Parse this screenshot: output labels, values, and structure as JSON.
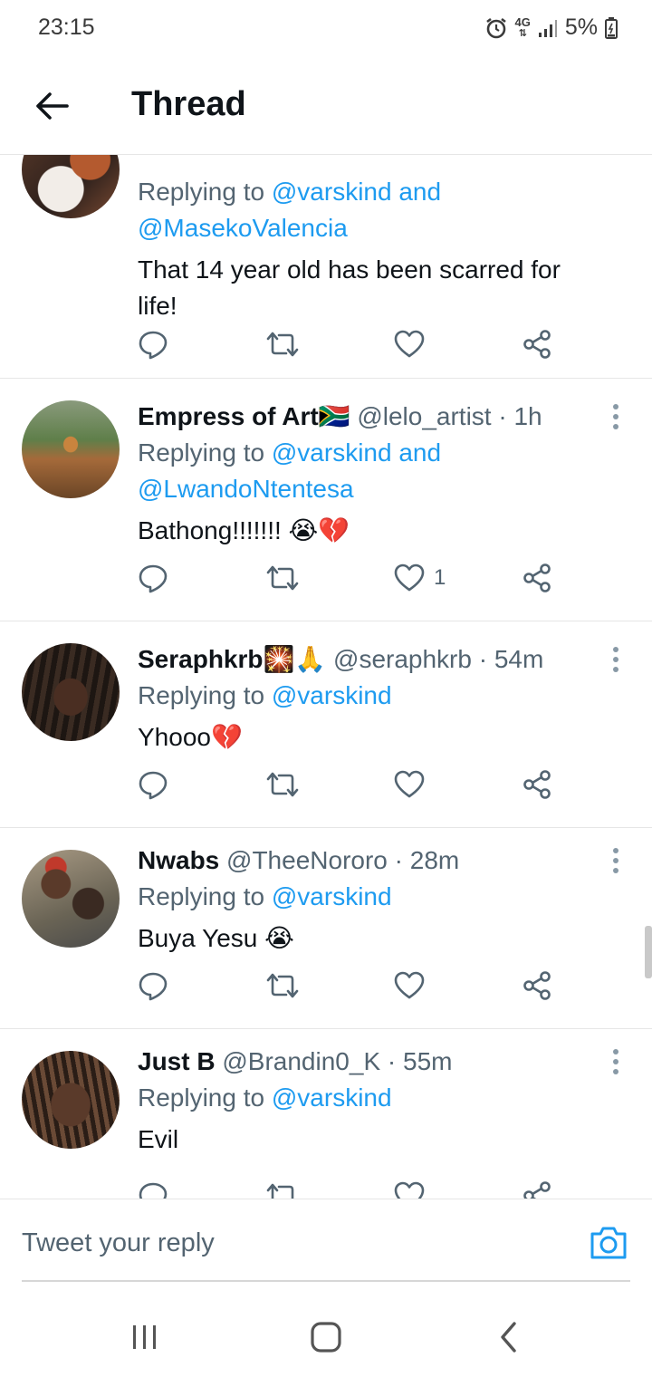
{
  "status_bar": {
    "time": "23:15",
    "network": "4G",
    "battery": "5%",
    "icons": [
      "alarm-icon",
      "network-4g-icon",
      "signal-icon",
      "battery-icon"
    ]
  },
  "header": {
    "title": "Thread",
    "back_icon": "back-arrow-icon"
  },
  "colors": {
    "accent": "#1d9bf0",
    "text": "#0f1419",
    "secondary": "#536471",
    "divider": "#e6e6e6"
  },
  "tweets": [
    {
      "name": "",
      "handle": "",
      "time": "",
      "replying_prefix": "Replying to",
      "replying_line1": "@varskind and",
      "replying_line2": "@MasekoValencia",
      "content_line1": "That 14 year old has been scarred for",
      "content_line2": "life!",
      "like_count": ""
    },
    {
      "name": "Empress of Art🇿🇦",
      "handle": "@lelo_artist",
      "time": "· 1h",
      "replying_prefix": "Replying to",
      "replying_line1": "@varskind and",
      "replying_line2": "@LwandoNtentesa",
      "content": "Bathong!!!!!!! 😭💔",
      "like_count": "1"
    },
    {
      "name": "Seraphkrb🎇🙏",
      "handle": "@seraphkrb",
      "time": "· 54m",
      "replying_prefix": "Replying to",
      "replying_line1": "@varskind",
      "content": "Yhooo💔",
      "like_count": ""
    },
    {
      "name": "Nwabs",
      "handle": "@TheeNororo",
      "time": "· 28m",
      "replying_prefix": "Replying to",
      "replying_line1": "@varskind",
      "content": "Buya Yesu 😭",
      "like_count": ""
    },
    {
      "name": "Just B",
      "handle": "@Brandin0_K",
      "time": "· 55m",
      "replying_prefix": "Replying to",
      "replying_line1": "@varskind",
      "content": "Evil",
      "like_count": ""
    }
  ],
  "reply_bar": {
    "placeholder": "Tweet your reply",
    "camera_icon": "camera-icon"
  },
  "nav_bar": {
    "icons": [
      "recent-apps-icon",
      "home-icon",
      "back-icon"
    ]
  }
}
